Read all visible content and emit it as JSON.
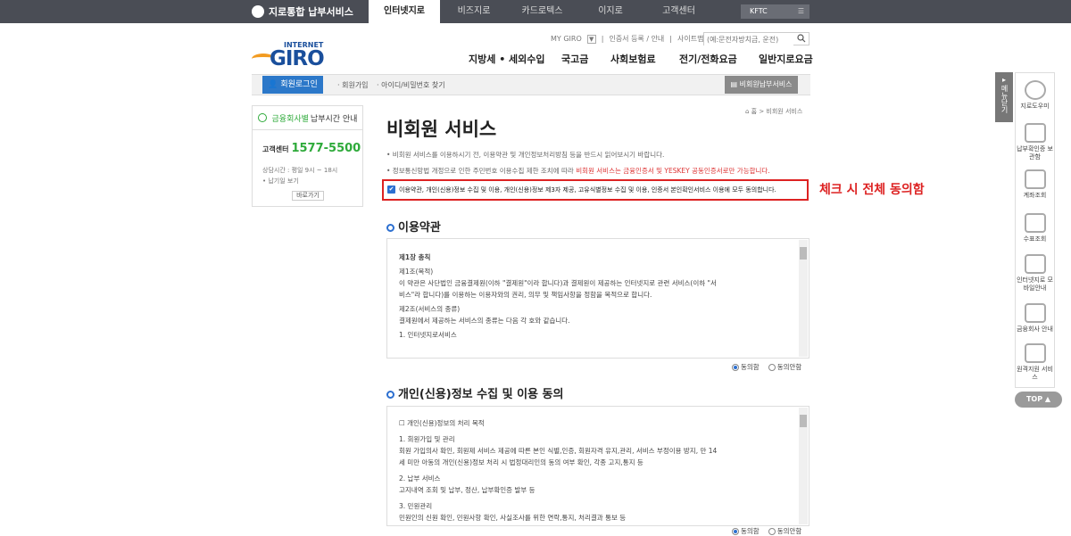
{
  "topbar": {
    "brand": "지로통합 납부서비스",
    "tabs": [
      "인터넷지로",
      "비즈지로",
      "카드로텍스",
      "이지로",
      "고객센터"
    ],
    "kftc": "KFTC"
  },
  "logo": {
    "sub": "INTERNET",
    "main": "GIRO"
  },
  "utils": {
    "my_giro": "MY GIRO",
    "dropdown": "▼",
    "links": "인증서 등록 / 안내",
    "sep": "|",
    "sitemap": "사이트맵"
  },
  "search": {
    "placeholder": "(예:문전자방치금, 운전)"
  },
  "gnb": [
    "지방세 • 세외수입",
    "국고금",
    "사회보험료",
    "전기/전화요금",
    "일반지로요금"
  ],
  "subbar": {
    "login": "회원로그인",
    "join": "회원가입",
    "find": "아이디/비밀번호 찾기",
    "nonmember": "비회원납부서비스"
  },
  "leftbox": {
    "hours_pre": "",
    "hours_highlight": "금융회사별",
    "hours_post": "납부시간 안내",
    "center_label": "고객센터",
    "center_num": "1577-5500",
    "hours_line1": "상담시간 : 평일 9시 ~ 18시",
    "hours_line2": "• 납기일 보기",
    "btn": "바로가기"
  },
  "breadcrumb": "홈 > 비회원 서비스",
  "page_title": "비회원 서비스",
  "notes": {
    "n1": "•   비회원 서비스를 이용하시기 전, 이용약관 및 개인정보처리방침 등을 반드시 읽어보시기 바랍니다.",
    "n2_pre": "•   정보통신망법 개정으로 인한 주민번호 이용수집 제한 조치에 따라 ",
    "n2_red": "비회원 서비스는 금융인증서 및 YESKEY 공동인증서로만 가능합니다."
  },
  "agree_all": {
    "checked": true,
    "text": "이용약관, 개인(신용)정보 수집 및 이용, 개인(신용)정보 제3자 제공, 고유식별정보 수집 및 이용, 인증서 본인확인서비스 이용에 모두 동의합니다."
  },
  "annotation": "체크 시 전체 동의함",
  "section1": {
    "title": "이용약관",
    "lines": [
      "제1장 총칙",
      "제1조(목적)",
      "이 약관은 사단법인 금융결제원(이하 \"결제원\"이라 합니다)과 결제원이 제공하는 인터넷지로 관련 서비스(이하 \"서",
      "비스\"라 합니다)를 이용하는 이용자와의 권리, 의무 및 책임사항을 정함을 목적으로 합니다.",
      "제2조(서비스의 종류)",
      "결제원에서 제공하는 서비스의 종류는 다음 각 호와 같습니다.",
      "1. 인터넷지로서비스"
    ],
    "agree": "동의함",
    "disagree": "동의안함"
  },
  "section2": {
    "title": "개인(신용)정보 수집 및 이용 동의",
    "lines": [
      "☐ 개인(신용)정보의 처리 목적",
      "1. 회원가입 및 관리",
      "회원 가입의사 확인, 회원제 서비스 제공에 따른 본인 식별,인증, 회원자격 유지,관리, 서비스 부정이용 방지, 만 14",
      "세 미만 아동의 개인(신용)정보 처리 시 법정대리인의 동의 여부 확인, 각종 고지,통지 등",
      "2. 납부 서비스",
      "고지내역 조회 및 납부, 정산, 납부확인증 발부 등",
      "3. 민원관리",
      "민원인의 신원 확인, 민원사항 확인, 사실조사를 위한 연락,통지, 처리결과 통보 등"
    ],
    "agree": "동의함",
    "disagree": "동의안함"
  },
  "rightbar": {
    "menu_tab": "메뉴닫기",
    "items": [
      "지로도우미",
      "납부확인증 보관함",
      "계좌조회",
      "수표조회",
      "인터넷지로 모바일안내",
      "금융회사 안내",
      "원격지원 서비스"
    ],
    "top": "TOP ▲"
  }
}
